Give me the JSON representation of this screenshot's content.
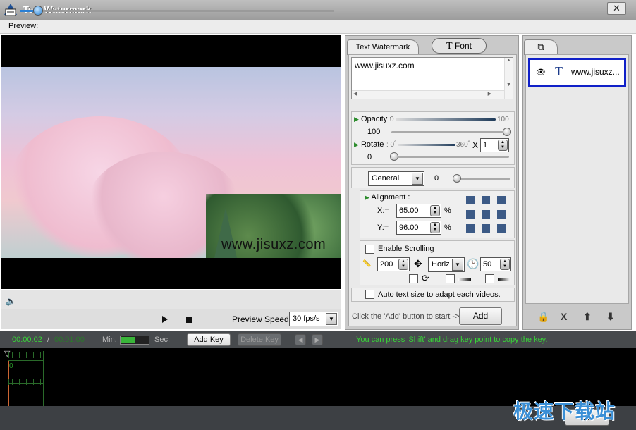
{
  "window": {
    "title": "Text Watermark",
    "close_glyph": "✕"
  },
  "menu": {
    "preview_label": "Preview:"
  },
  "video": {
    "watermark_text": "www.jisuxz.com",
    "seek_progress": 0.06
  },
  "controls": {
    "preview_speed_label": "Preview Speed:",
    "preview_speed_value": "30 fps/s"
  },
  "tabs": {
    "text_watermark": "Text Watermark",
    "font": "Font",
    "font_icon": "T"
  },
  "text_panel": {
    "text": "www.jisuxz.com",
    "opacity": {
      "label": "Opacity :",
      "min": "0",
      "max": "100",
      "value": "100"
    },
    "rotate": {
      "label": "Rotate",
      "min": ": 0˚",
      "max": "360˚",
      "x": "X",
      "multiplier": "1",
      "value": "0"
    },
    "effect": {
      "selected": "General",
      "value": "0"
    },
    "alignment": {
      "label": "Alignment :",
      "x_label": "X:=",
      "x_value": "65.00",
      "y_label": "Y:=",
      "y_value": "96.00",
      "percent": "%"
    },
    "scrolling": {
      "label": "Enable Scrolling",
      "speed": "200",
      "direction": "Horiz",
      "count": "50"
    },
    "auto_size_label": "Auto text size to adapt each videos.",
    "hint": "Click the 'Add' button to start ->",
    "add_button": "Add"
  },
  "layers": {
    "items": [
      {
        "label": "www.jisuxz..."
      }
    ],
    "buttons": {
      "lock": "🔒",
      "delete": "X",
      "up": "⬆",
      "down": "⬇"
    }
  },
  "timeline": {
    "current_time": "00:00:02",
    "separator": "/",
    "total_time": "00:01:00",
    "min_label": "Min.",
    "sec_label": "Sec.",
    "add_key": "Add Key",
    "delete_key": "Delete Key",
    "hint": "You can press 'Shift' and drag key point to copy the key.",
    "marker": "0"
  },
  "footer": {
    "ok_button": "OK",
    "site_logo": "极速下载站"
  }
}
